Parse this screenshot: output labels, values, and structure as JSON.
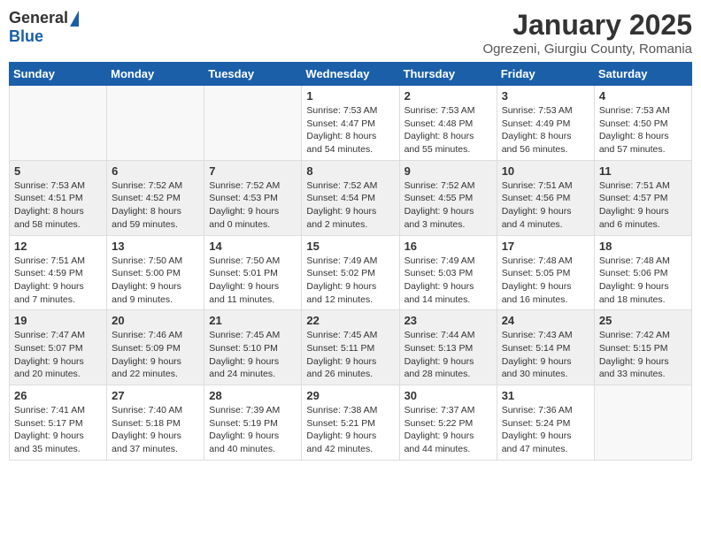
{
  "header": {
    "logo_general": "General",
    "logo_blue": "Blue",
    "month_title": "January 2025",
    "location": "Ogrezeni, Giurgiu County, Romania"
  },
  "days_of_week": [
    "Sunday",
    "Monday",
    "Tuesday",
    "Wednesday",
    "Thursday",
    "Friday",
    "Saturday"
  ],
  "weeks": [
    [
      {
        "day": "",
        "info": ""
      },
      {
        "day": "",
        "info": ""
      },
      {
        "day": "",
        "info": ""
      },
      {
        "day": "1",
        "info": "Sunrise: 7:53 AM\nSunset: 4:47 PM\nDaylight: 8 hours\nand 54 minutes."
      },
      {
        "day": "2",
        "info": "Sunrise: 7:53 AM\nSunset: 4:48 PM\nDaylight: 8 hours\nand 55 minutes."
      },
      {
        "day": "3",
        "info": "Sunrise: 7:53 AM\nSunset: 4:49 PM\nDaylight: 8 hours\nand 56 minutes."
      },
      {
        "day": "4",
        "info": "Sunrise: 7:53 AM\nSunset: 4:50 PM\nDaylight: 8 hours\nand 57 minutes."
      }
    ],
    [
      {
        "day": "5",
        "info": "Sunrise: 7:53 AM\nSunset: 4:51 PM\nDaylight: 8 hours\nand 58 minutes."
      },
      {
        "day": "6",
        "info": "Sunrise: 7:52 AM\nSunset: 4:52 PM\nDaylight: 8 hours\nand 59 minutes."
      },
      {
        "day": "7",
        "info": "Sunrise: 7:52 AM\nSunset: 4:53 PM\nDaylight: 9 hours\nand 0 minutes."
      },
      {
        "day": "8",
        "info": "Sunrise: 7:52 AM\nSunset: 4:54 PM\nDaylight: 9 hours\nand 2 minutes."
      },
      {
        "day": "9",
        "info": "Sunrise: 7:52 AM\nSunset: 4:55 PM\nDaylight: 9 hours\nand 3 minutes."
      },
      {
        "day": "10",
        "info": "Sunrise: 7:51 AM\nSunset: 4:56 PM\nDaylight: 9 hours\nand 4 minutes."
      },
      {
        "day": "11",
        "info": "Sunrise: 7:51 AM\nSunset: 4:57 PM\nDaylight: 9 hours\nand 6 minutes."
      }
    ],
    [
      {
        "day": "12",
        "info": "Sunrise: 7:51 AM\nSunset: 4:59 PM\nDaylight: 9 hours\nand 7 minutes."
      },
      {
        "day": "13",
        "info": "Sunrise: 7:50 AM\nSunset: 5:00 PM\nDaylight: 9 hours\nand 9 minutes."
      },
      {
        "day": "14",
        "info": "Sunrise: 7:50 AM\nSunset: 5:01 PM\nDaylight: 9 hours\nand 11 minutes."
      },
      {
        "day": "15",
        "info": "Sunrise: 7:49 AM\nSunset: 5:02 PM\nDaylight: 9 hours\nand 12 minutes."
      },
      {
        "day": "16",
        "info": "Sunrise: 7:49 AM\nSunset: 5:03 PM\nDaylight: 9 hours\nand 14 minutes."
      },
      {
        "day": "17",
        "info": "Sunrise: 7:48 AM\nSunset: 5:05 PM\nDaylight: 9 hours\nand 16 minutes."
      },
      {
        "day": "18",
        "info": "Sunrise: 7:48 AM\nSunset: 5:06 PM\nDaylight: 9 hours\nand 18 minutes."
      }
    ],
    [
      {
        "day": "19",
        "info": "Sunrise: 7:47 AM\nSunset: 5:07 PM\nDaylight: 9 hours\nand 20 minutes."
      },
      {
        "day": "20",
        "info": "Sunrise: 7:46 AM\nSunset: 5:09 PM\nDaylight: 9 hours\nand 22 minutes."
      },
      {
        "day": "21",
        "info": "Sunrise: 7:45 AM\nSunset: 5:10 PM\nDaylight: 9 hours\nand 24 minutes."
      },
      {
        "day": "22",
        "info": "Sunrise: 7:45 AM\nSunset: 5:11 PM\nDaylight: 9 hours\nand 26 minutes."
      },
      {
        "day": "23",
        "info": "Sunrise: 7:44 AM\nSunset: 5:13 PM\nDaylight: 9 hours\nand 28 minutes."
      },
      {
        "day": "24",
        "info": "Sunrise: 7:43 AM\nSunset: 5:14 PM\nDaylight: 9 hours\nand 30 minutes."
      },
      {
        "day": "25",
        "info": "Sunrise: 7:42 AM\nSunset: 5:15 PM\nDaylight: 9 hours\nand 33 minutes."
      }
    ],
    [
      {
        "day": "26",
        "info": "Sunrise: 7:41 AM\nSunset: 5:17 PM\nDaylight: 9 hours\nand 35 minutes."
      },
      {
        "day": "27",
        "info": "Sunrise: 7:40 AM\nSunset: 5:18 PM\nDaylight: 9 hours\nand 37 minutes."
      },
      {
        "day": "28",
        "info": "Sunrise: 7:39 AM\nSunset: 5:19 PM\nDaylight: 9 hours\nand 40 minutes."
      },
      {
        "day": "29",
        "info": "Sunrise: 7:38 AM\nSunset: 5:21 PM\nDaylight: 9 hours\nand 42 minutes."
      },
      {
        "day": "30",
        "info": "Sunrise: 7:37 AM\nSunset: 5:22 PM\nDaylight: 9 hours\nand 44 minutes."
      },
      {
        "day": "31",
        "info": "Sunrise: 7:36 AM\nSunset: 5:24 PM\nDaylight: 9 hours\nand 47 minutes."
      },
      {
        "day": "",
        "info": ""
      }
    ]
  ]
}
